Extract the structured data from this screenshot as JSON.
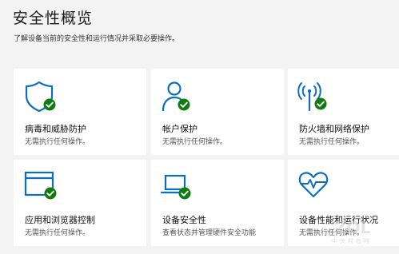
{
  "header": {
    "title": "安全性概览",
    "subtitle": "了解设备当前的安全性和运行情况并采取必要操作。"
  },
  "colors": {
    "accent": "#0a6fc2",
    "ok_badge": "#107c10",
    "card_bg": "#ffffff",
    "page_bg": "#f3f3f3"
  },
  "cards": [
    {
      "icon": "shield-icon",
      "title": "病毒和威胁防护",
      "status": "无需执行任何操作。"
    },
    {
      "icon": "user-icon",
      "title": "帐户保护",
      "status": "无需执行任何操作。"
    },
    {
      "icon": "wifi-antenna-icon",
      "title": "防火墙和网络保护",
      "status": "无需执行任何操作。"
    },
    {
      "icon": "browser-window-icon",
      "title": "应用和浏览器控制",
      "status": "无需执行任何操作。"
    },
    {
      "icon": "laptop-icon",
      "title": "设备安全性",
      "status": "查看状态并管理硬件安全功能"
    },
    {
      "icon": "heart-pulse-icon",
      "title": "设备性能和运行状况",
      "status": "无需执行任何操作。"
    }
  ],
  "watermark": {
    "logo_text": "ZOL",
    "caption": "中关村在线"
  }
}
